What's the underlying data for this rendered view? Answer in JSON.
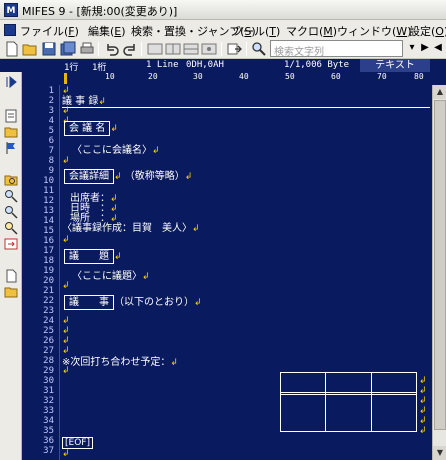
{
  "window": {
    "title": "MIFES 9 - [新規:00(変更あり)]",
    "app_icon": "M"
  },
  "menu": [
    {
      "label": "ファイル(",
      "key": "F",
      "end": ")"
    },
    {
      "label": "編集(",
      "key": "E",
      "end": ")"
    },
    {
      "label": "検索・置換・ジャンプ(",
      "key": "S",
      "end": ")"
    },
    {
      "label": "ツール(",
      "key": "T",
      "end": ")"
    },
    {
      "label": "マクロ(",
      "key": "M",
      "end": ")"
    },
    {
      "label": "ウィンドウ(",
      "key": "W",
      "end": ")"
    },
    {
      "label": "設定(",
      "key": "O",
      "end": ")"
    }
  ],
  "toolbar": {
    "search_placeholder": "検索文字列",
    "icons": [
      "new-file-icon",
      "open-folder-icon",
      "save-icon",
      "save-all-icon",
      "print-icon",
      "undo-icon",
      "redo-icon",
      "layout-1-icon",
      "layout-2-icon",
      "layout-3-icon",
      "layout-4-icon",
      "jump-icon",
      "search-icon",
      "search-next-icon",
      "search-prev-icon"
    ]
  },
  "status": {
    "line": "1行",
    "col": "1桁",
    "lines": "1 Line",
    "char_code": "0DH,0AH",
    "size": "1/1,006 Byte",
    "mode": "テキスト"
  },
  "ruler": {
    "marks": [
      "10",
      "20",
      "30",
      "40",
      "50",
      "60",
      "70",
      "80"
    ]
  },
  "editor": {
    "line_numbers": [
      "1",
      "2",
      "3",
      "4",
      "5",
      "6",
      "7",
      "8",
      "9",
      "10",
      "11",
      "12",
      "13",
      "14",
      "15",
      "16",
      "17",
      "18",
      "19",
      "20",
      "21",
      "22",
      "23",
      "24",
      "25",
      "26",
      "27",
      "28",
      "29",
      "30",
      "31",
      "32",
      "33",
      "34",
      "35",
      "36",
      "37"
    ],
    "newline_mark": "↲",
    "heading": "議 事 録",
    "section_meeting": "会 議 名",
    "meeting_placeholder": "〈ここに会議名〉",
    "section_detail": "会議詳細",
    "detail_note": "（敬称等略）",
    "attendees": "出席者：",
    "datetime": "日時　：",
    "place": "場所　：",
    "author": "〈議事録作成：目賀　美人〉",
    "section_topic": "議　　題",
    "topic_placeholder": "〈ここに議題〉",
    "section_minutes": "議　　事",
    "minutes_note": "（以下のとおり）",
    "next_meeting": "※次回打ち合わせ予定：",
    "eof": "[EOF]"
  }
}
